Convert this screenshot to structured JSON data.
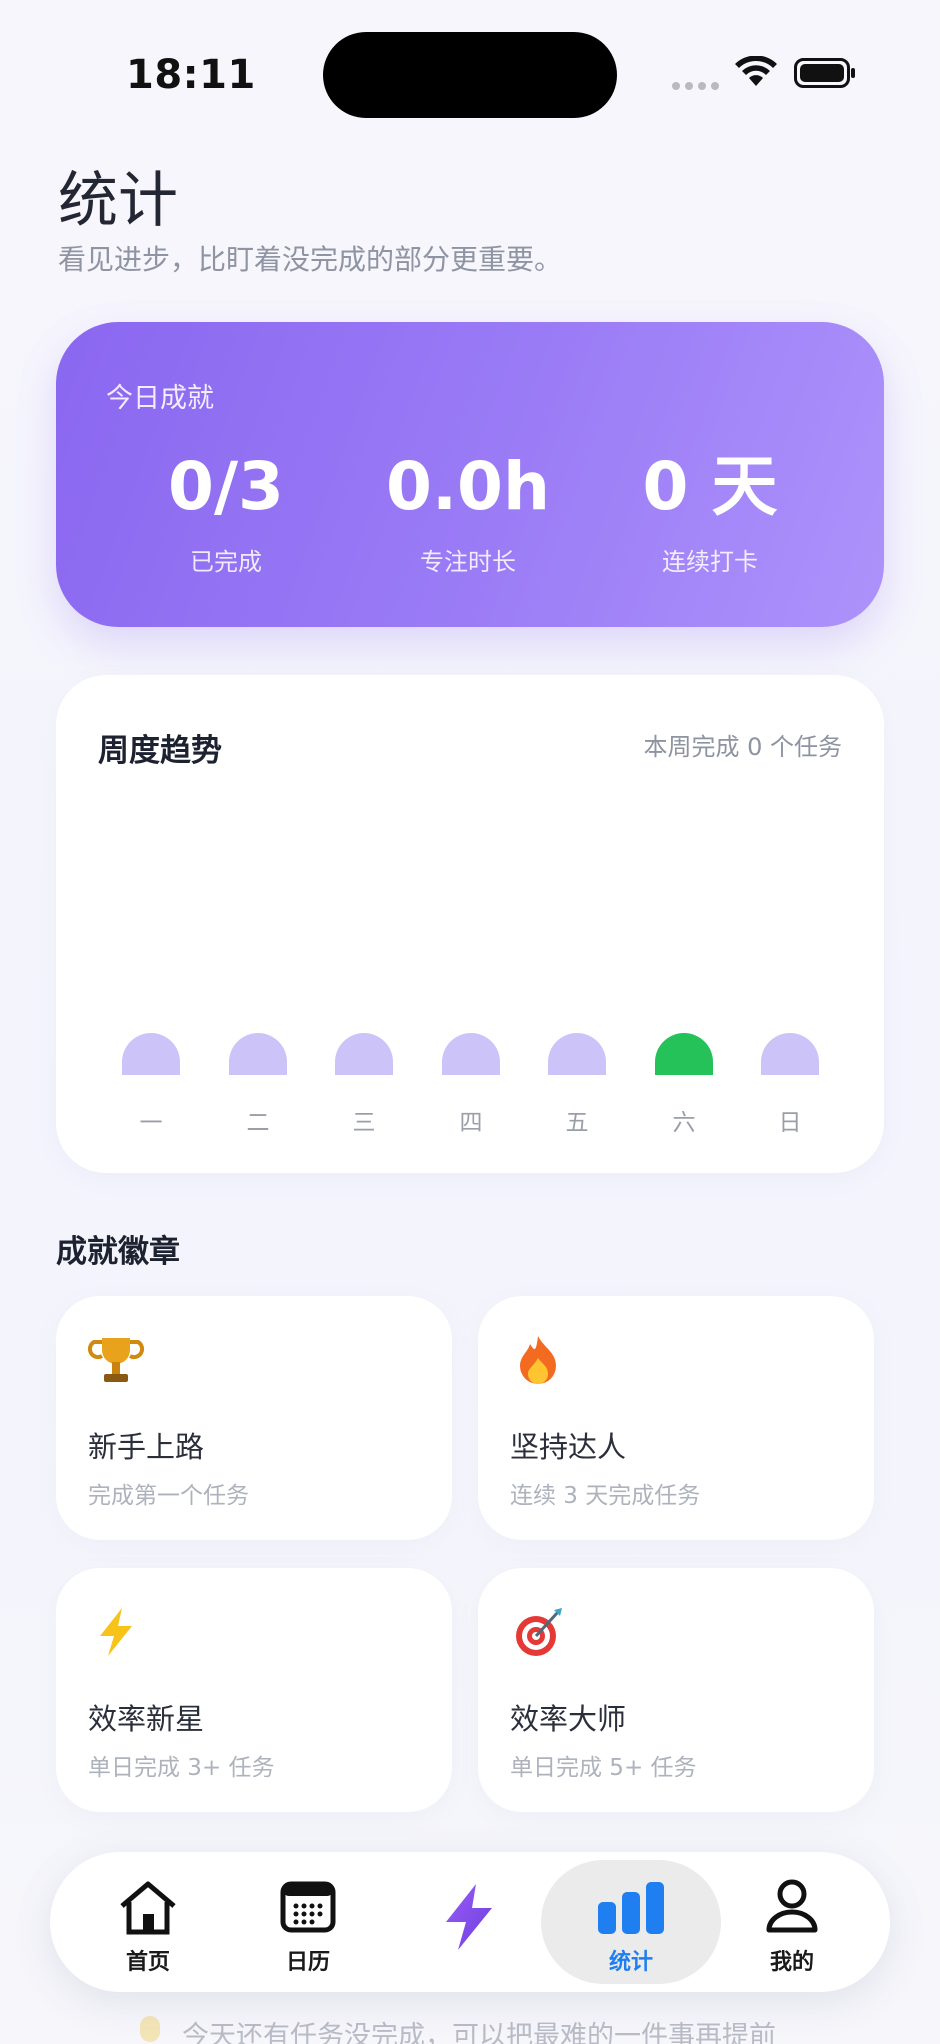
{
  "status_bar": {
    "time": "18:11"
  },
  "header": {
    "title": "统计",
    "subtitle": "看见进步，比盯着没完成的部分更重要。"
  },
  "today": {
    "title": "今日成就",
    "stats": [
      {
        "value": "0/3",
        "label": "已完成"
      },
      {
        "value": "0.0h",
        "label": "专注时长"
      },
      {
        "value": "0 天",
        "label": "连续打卡"
      }
    ]
  },
  "weekly": {
    "title": "周度趋势",
    "summary": "本周完成 0 个任务",
    "days": [
      "一",
      "二",
      "三",
      "四",
      "五",
      "六",
      "日"
    ],
    "completed": [
      0,
      0,
      0,
      0,
      0,
      0,
      0
    ],
    "today_index": 5,
    "colors": {
      "bar": "#ccc3f8",
      "today": "#25c25a"
    }
  },
  "badges": {
    "title": "成就徽章",
    "items": [
      {
        "icon": "trophy-icon",
        "name": "新手上路",
        "desc": "完成第一个任务"
      },
      {
        "icon": "fire-icon",
        "name": "坚持达人",
        "desc": "连续 3 天完成任务"
      },
      {
        "icon": "lightning-icon",
        "name": "效率新星",
        "desc": "单日完成 3+ 任务"
      },
      {
        "icon": "target-icon",
        "name": "效率大师",
        "desc": "单日完成 5+ 任务"
      }
    ]
  },
  "peek": {
    "text": "今天还有任务没完成，可以把最难的一件事再提前"
  },
  "tabbar": {
    "tabs": [
      {
        "label": "首页",
        "icon": "home-icon"
      },
      {
        "label": "日历",
        "icon": "calendar-icon"
      },
      {
        "label": "",
        "icon": "lightning-icon"
      },
      {
        "label": "统计",
        "icon": "bar-chart-icon",
        "active": true
      },
      {
        "label": "我的",
        "icon": "person-icon"
      }
    ],
    "accent": "#1f7ef0"
  }
}
